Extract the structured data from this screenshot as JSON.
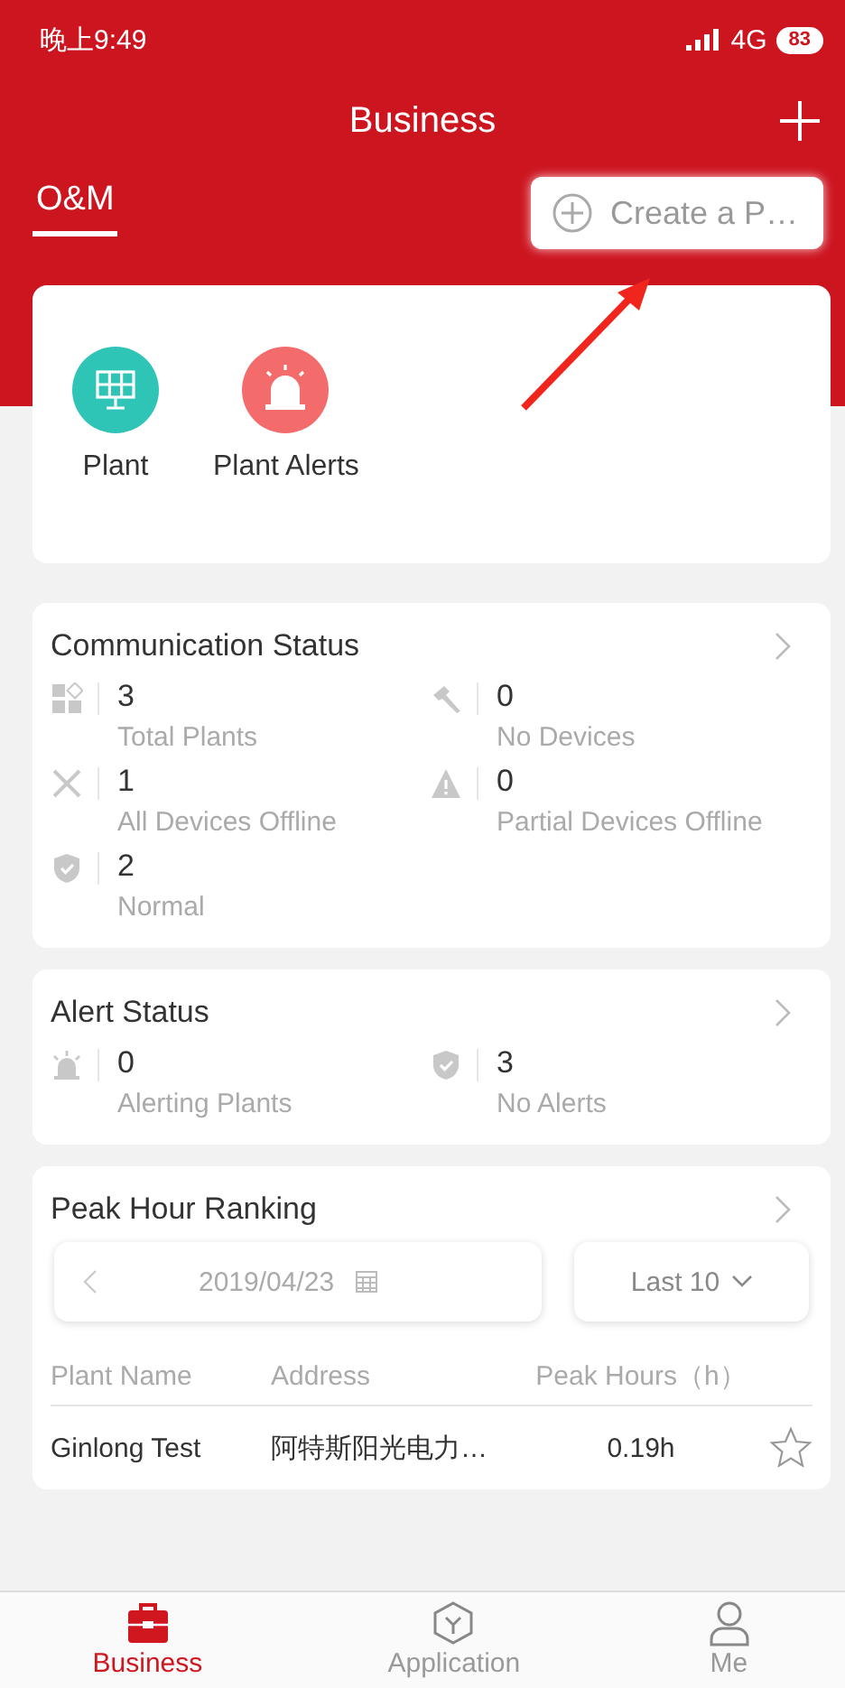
{
  "status_bar": {
    "time": "晚上9:49",
    "network": "4G",
    "battery": "83"
  },
  "header": {
    "title": "Business"
  },
  "tabs": [
    {
      "label": "O&M",
      "selected": true
    }
  ],
  "create_button": {
    "label": "Create a P…"
  },
  "shortcuts": [
    {
      "label": "Plant",
      "kind": "plant",
      "color": "#2ec4b6"
    },
    {
      "label": "Plant Alerts",
      "kind": "alert",
      "color": "#f46b6b"
    }
  ],
  "communication_status": {
    "title": "Communication Status",
    "stats": [
      {
        "kind": "grid",
        "value": "3",
        "label": "Total Plants"
      },
      {
        "kind": "hammer",
        "value": "0",
        "label": "No Devices"
      },
      {
        "kind": "cross",
        "value": "1",
        "label": "All Devices Offline"
      },
      {
        "kind": "warning",
        "value": "0",
        "label": "Partial Devices Offline"
      },
      {
        "kind": "shield",
        "value": "2",
        "label": "Normal"
      }
    ]
  },
  "alert_status": {
    "title": "Alert Status",
    "stats": [
      {
        "kind": "siren",
        "value": "0",
        "label": "Alerting Plants"
      },
      {
        "kind": "shield",
        "value": "3",
        "label": "No Alerts"
      }
    ]
  },
  "peak_hour_ranking": {
    "title": "Peak Hour Ranking",
    "date": "2019/04/23",
    "range": "Last 10",
    "columns": [
      "Plant Name",
      "Address",
      "Peak Hours（h）"
    ],
    "rows": [
      {
        "plant_name": "Ginlong Test",
        "address": "阿特斯阳光电力…",
        "peak_hours": "0.19h",
        "starred": false
      }
    ]
  },
  "bottom_nav": [
    {
      "label": "Business",
      "kind": "briefcase",
      "selected": true
    },
    {
      "label": "Application",
      "kind": "cube",
      "selected": false
    },
    {
      "label": "Me",
      "kind": "person",
      "selected": false
    }
  ]
}
